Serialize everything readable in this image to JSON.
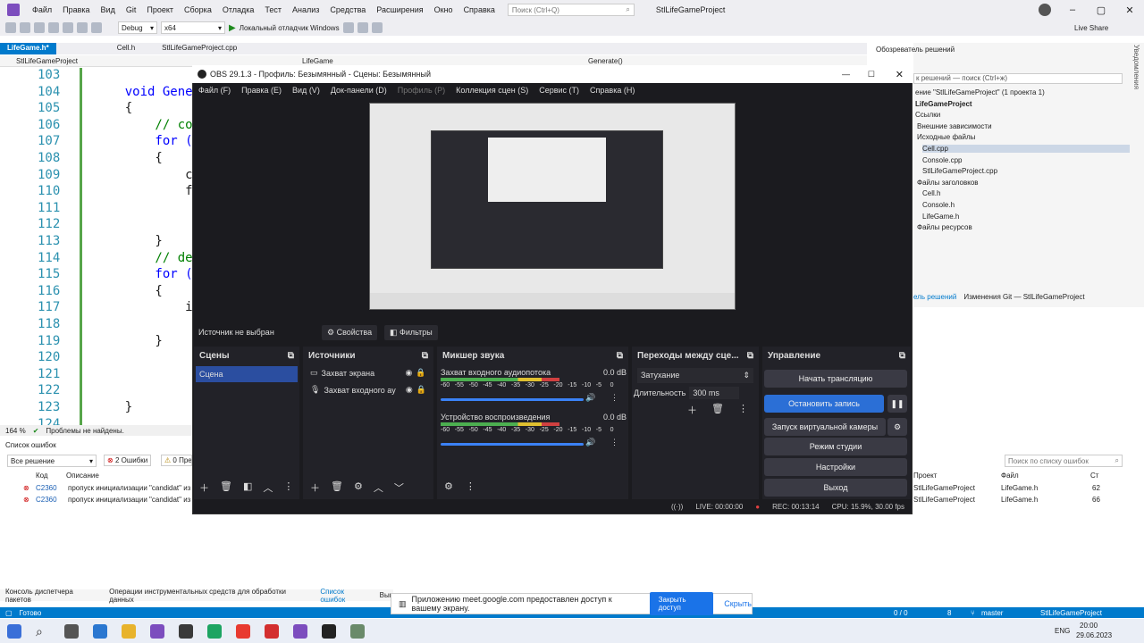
{
  "vs": {
    "menu": [
      "Файл",
      "Правка",
      "Вид",
      "Git",
      "Проект",
      "Сборка",
      "Отладка",
      "Тест",
      "Анализ",
      "Средства",
      "Расширения",
      "Окно",
      "Справка"
    ],
    "search_placeholder": "Поиск (Ctrl+Q)",
    "solution_name": "StlLifeGameProject",
    "toolbar": {
      "config": "Debug",
      "platform": "x64",
      "run_label": "Локальный отладчик Windows",
      "live_share": "Live Share"
    },
    "tabs": [
      "LifeGame.h*",
      "Cell.h",
      "StlLifeGameProject.cpp"
    ],
    "nav": {
      "scope": "StlLifeGameProject",
      "class": "LifeGame",
      "member": "Generate()"
    },
    "line_numbers": [
      "103",
      "104",
      "105",
      "106",
      "107",
      "108",
      "109",
      "110",
      "111",
      "112",
      "113",
      "114",
      "115",
      "116",
      "117",
      "118",
      "119",
      "120",
      "121",
      "122",
      "123",
      "124"
    ],
    "code": [
      {
        "n": "104",
        "text": "    void Gene"
      },
      {
        "n": "105",
        "text": "    {"
      },
      {
        "n": "106",
        "text": "        // co"
      },
      {
        "n": "107",
        "text": "        for ("
      },
      {
        "n": "108",
        "text": "        {"
      },
      {
        "n": "109",
        "text": "            c"
      },
      {
        "n": "110",
        "text": "            f"
      },
      {
        "n": "113",
        "text": "        }"
      },
      {
        "n": "114",
        "text": "        // de"
      },
      {
        "n": "115",
        "text": "        for ("
      },
      {
        "n": "116",
        "text": "        {"
      },
      {
        "n": "117",
        "text": "            i"
      },
      {
        "n": "119",
        "text": "        }"
      },
      {
        "n": "123",
        "text": "    }"
      }
    ],
    "zoom": "164 %",
    "problems": "Проблемы не найдены.",
    "error_list": {
      "title": "Список ошибок",
      "filter": "Все решение",
      "errors_badge": "2 Ошибки",
      "warnings_badge": "0 Пре",
      "search_placeholder": "Поиск по списку ошибок",
      "headers": [
        "Код",
        "Описание",
        "Проект",
        "Файл",
        "Ст"
      ],
      "rows": [
        {
          "code": "C2360",
          "desc": "пропуск инициализации \"candidat\" из",
          "project": "StlLifeGameProject",
          "file": "LifeGame.h",
          "line": "62"
        },
        {
          "code": "C2360",
          "desc": "пропуск инициализации \"candidat\" из",
          "project": "StlLifeGameProject",
          "file": "LifeGame.h",
          "line": "66"
        }
      ]
    },
    "bottom_tabs": [
      "Консоль диспетчера пакетов",
      "Операции инструментальных средств для обработки данных",
      "Список ошибок",
      "Выв"
    ],
    "status": {
      "ready": "Готово",
      "lines": "0 / 0",
      "changes": "8",
      "branch": "master",
      "project": "StlLifeGameProject"
    },
    "solution_explorer": {
      "title": "Обозреватель решений",
      "search": "к решений — поиск (Ctrl+ж)",
      "items": [
        "ение \"StlLifeGameProject\" (1 проекта 1)",
        "LifeGameProject",
        "Ссылки",
        "Внешние зависимости",
        "Исходные файлы",
        "Cell.cpp",
        "Console.cpp",
        "StlLifeGameProject.cpp",
        "Файлы заголовков",
        "Cell.h",
        "Console.h",
        "LifeGame.h",
        "Файлы ресурсов"
      ],
      "footer_tabs": [
        "ель решений",
        "Изменения Git — StlLifeGameProject"
      ]
    },
    "side_label": "Уведомления"
  },
  "obs": {
    "title": "OBS 29.1.3 - Профиль: Безымянный - Сцены: Безымянный",
    "menu": [
      "Файл (F)",
      "Правка (E)",
      "Вид (V)",
      "Док-панели (D)",
      "Профиль (P)",
      "Коллекция сцен (S)",
      "Сервис (T)",
      "Справка (H)"
    ],
    "source_status": "Источник не выбран",
    "properties": "Свойства",
    "filters": "Фильтры",
    "scenes": {
      "title": "Сцены",
      "items": [
        "Сцена"
      ]
    },
    "sources": {
      "title": "Источники",
      "items": [
        "Захват экрана",
        "Захват входного ау"
      ]
    },
    "mixer": {
      "title": "Микшер звука",
      "channels": [
        {
          "name": "Захват входного аудиопотока",
          "db": "0.0 dB",
          "level": 0.65
        },
        {
          "name": "Устройство воспроизведения",
          "db": "0.0 dB",
          "level": 0.65
        }
      ],
      "scale": [
        "-60",
        "-55",
        "-50",
        "-45",
        "-40",
        "-35",
        "-30",
        "-25",
        "-20",
        "-15",
        "-10",
        "-5",
        "0"
      ]
    },
    "transitions": {
      "title": "Переходы между сце...",
      "type": "Затухание",
      "duration_label": "Длительность",
      "duration": "300 ms"
    },
    "controls": {
      "title": "Управление",
      "start_stream": "Начать трансляцию",
      "stop_record": "Остановить запись",
      "virtual_cam": "Запуск виртуальной камеры",
      "studio_mode": "Режим студии",
      "settings": "Настройки",
      "exit": "Выход"
    },
    "status": {
      "live": "LIVE: 00:00:00",
      "rec": "REC: 00:13:14",
      "cpu": "CPU: 15.9%, 30.00 fps"
    }
  },
  "meet": {
    "message": "Приложению meet.google.com предоставлен доступ к вашему экрану.",
    "close_access": "Закрыть доступ",
    "hide": "Скрыть"
  },
  "taskbar": {
    "lang": "ENG",
    "time": "20:00",
    "date": "29.06.2023"
  }
}
